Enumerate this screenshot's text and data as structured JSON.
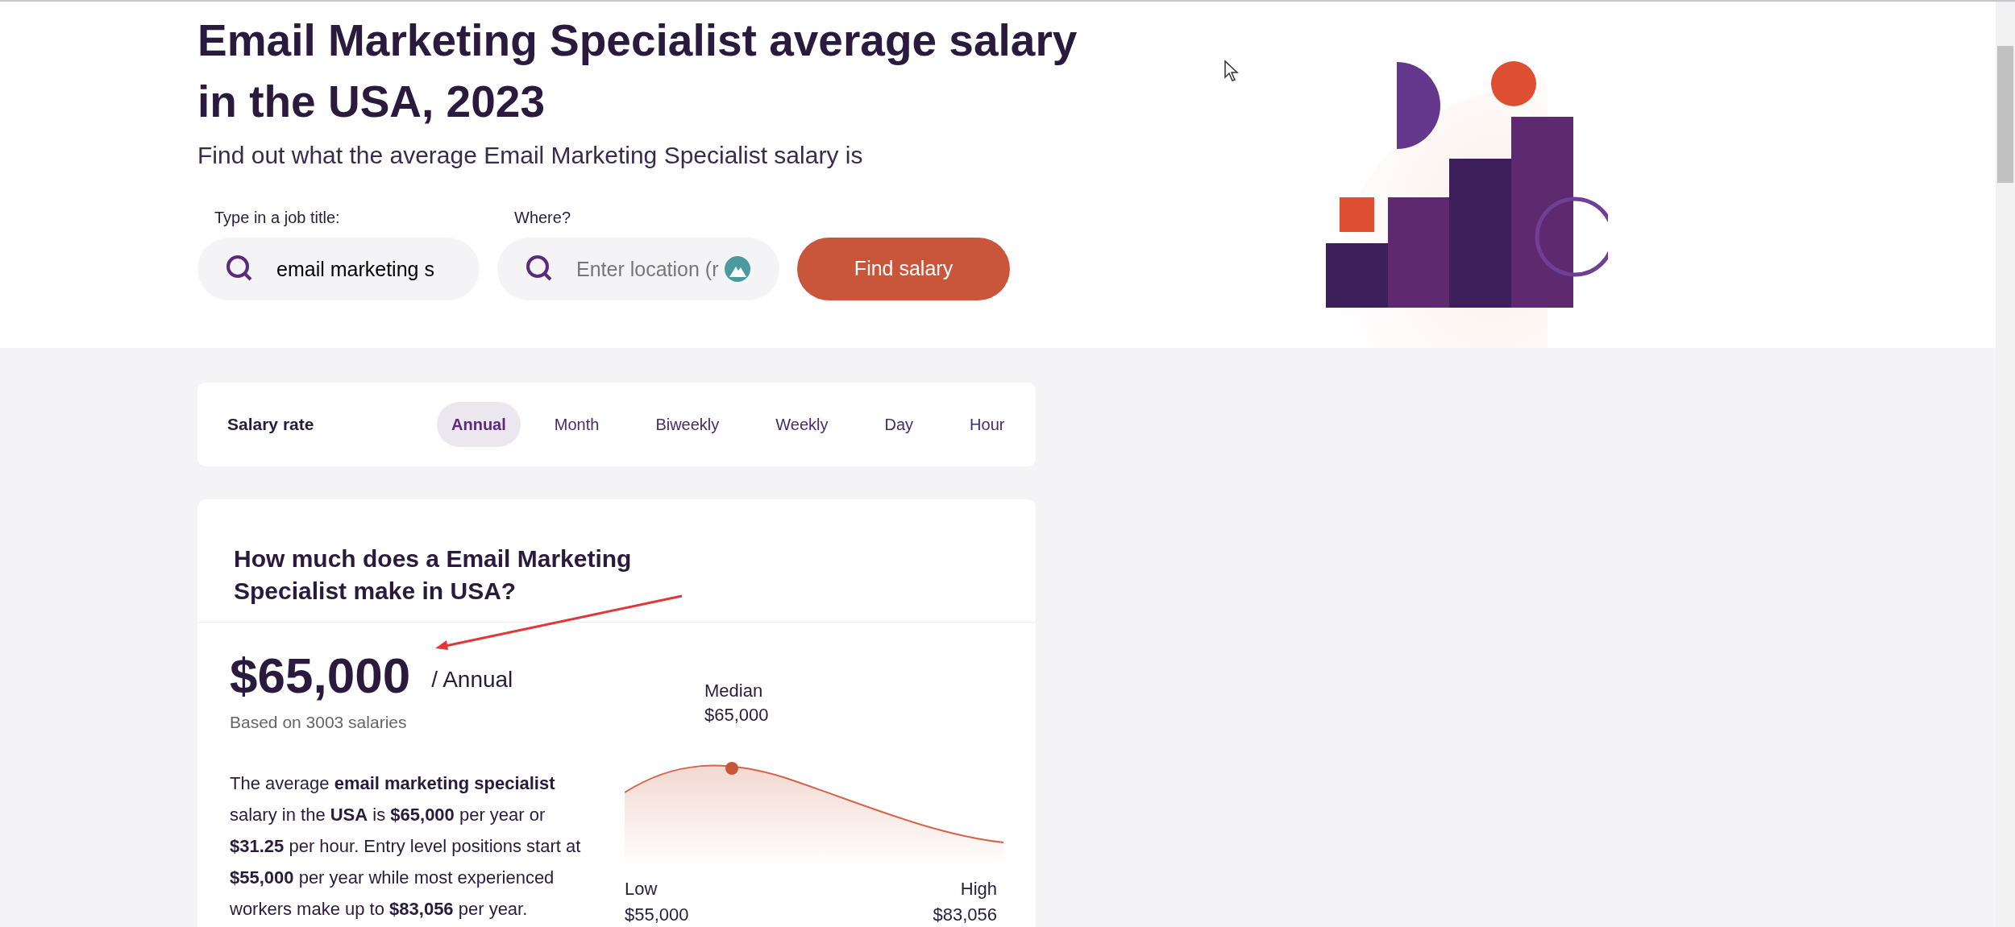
{
  "hero": {
    "title": "Email Marketing Specialist average salary in the USA, 2023",
    "subtitle": "Find out what the average Email Marketing Specialist salary is",
    "search": {
      "job_label": "Type in a job title:",
      "job_value": "email marketing s",
      "where_label": "Where?",
      "where_placeholder": "Enter location (r",
      "button": "Find salary"
    }
  },
  "salary_rate": {
    "label": "Salary rate",
    "tabs": [
      {
        "label": "Annual",
        "selected": true
      },
      {
        "label": "Month",
        "selected": false
      },
      {
        "label": "Biweekly",
        "selected": false
      },
      {
        "label": "Weekly",
        "selected": false
      },
      {
        "label": "Day",
        "selected": false
      },
      {
        "label": "Hour",
        "selected": false
      }
    ]
  },
  "summary": {
    "heading": "How much does a Email Marketing Specialist make in USA?",
    "amount": "$65,000",
    "period": "/ Annual",
    "based_on": "Based on 3003 salaries",
    "paragraph": "The average **email marketing specialist** salary in the **USA** is **$65,000** per year or **$31.25** per hour. Entry level positions start at **$55,000** per year while most experienced workers make up to **$83,056** per year.",
    "median_label": "Median",
    "median_value": "$65,000",
    "low_label": "Low",
    "low_value": "$55,000",
    "high_label": "High",
    "high_value": "$83,056"
  }
}
